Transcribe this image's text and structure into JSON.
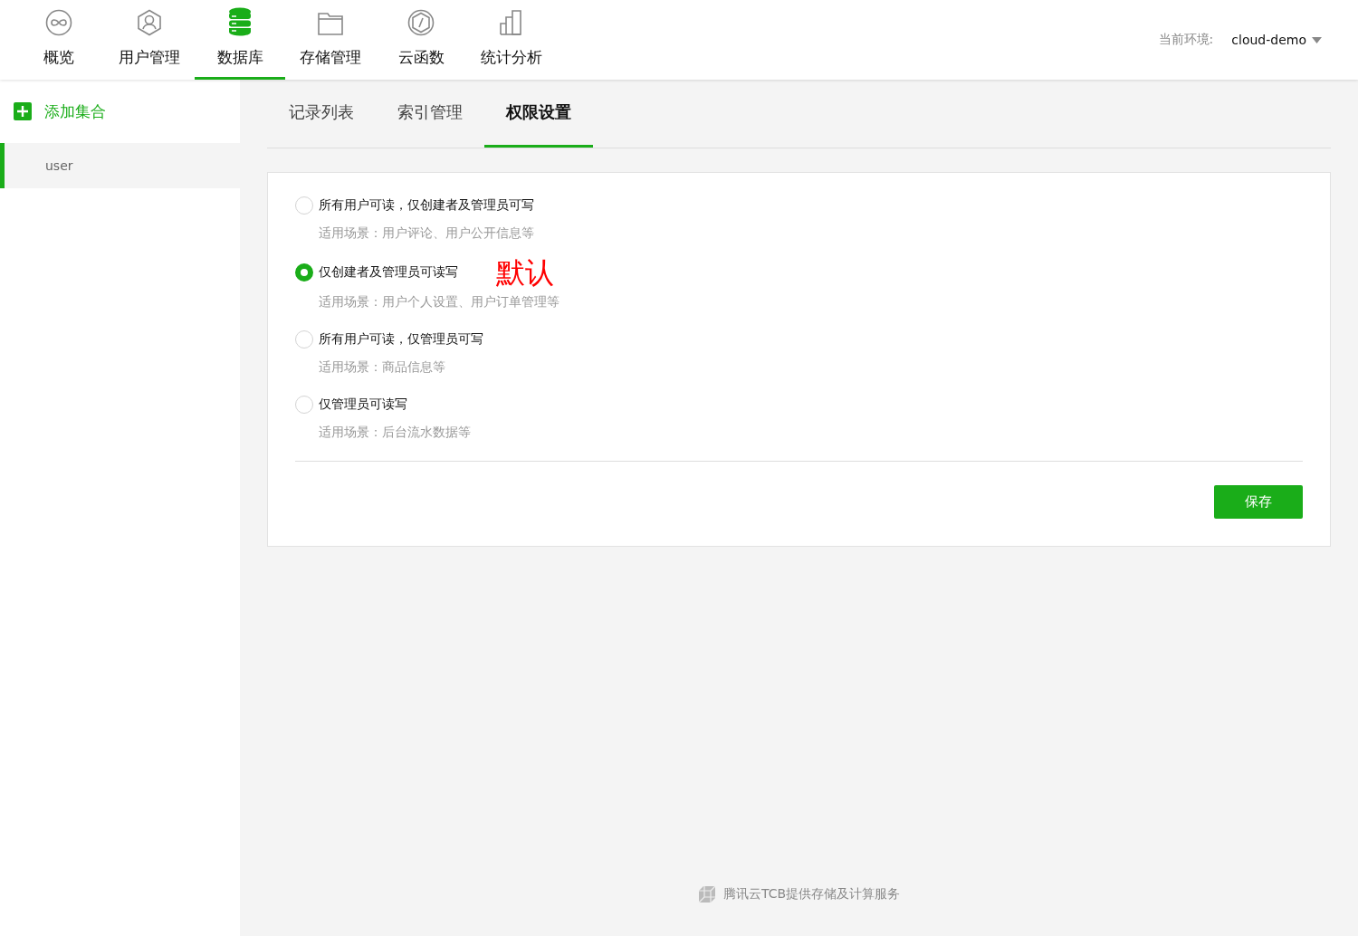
{
  "nav": [
    {
      "label": "概览",
      "selected": false
    },
    {
      "label": "用户管理",
      "selected": false
    },
    {
      "label": "数据库",
      "selected": true
    },
    {
      "label": "存储管理",
      "selected": false
    },
    {
      "label": "云函数",
      "selected": false
    },
    {
      "label": "统计分析",
      "selected": false
    }
  ],
  "environment": {
    "label": "当前环境:",
    "value": "cloud-demo"
  },
  "sidebar": {
    "add_button": "添加集合",
    "items": [
      {
        "label": "user",
        "selected": true
      }
    ]
  },
  "tabs": [
    {
      "label": "记录列表",
      "selected": false
    },
    {
      "label": "索引管理",
      "selected": false
    },
    {
      "label": "权限设置",
      "selected": true
    }
  ],
  "permissions": [
    {
      "label": "所有用户可读，仅创建者及管理员可写",
      "hint": "适用场景：用户评论、用户公开信息等",
      "selected": false
    },
    {
      "label": "仅创建者及管理员可读写",
      "hint": "适用场景：用户个人设置、用户订单管理等",
      "selected": true,
      "annotation": "默认"
    },
    {
      "label": "所有用户可读，仅管理员可写",
      "hint": "适用场景：商品信息等",
      "selected": false
    },
    {
      "label": "仅管理员可读写",
      "hint": "适用场景：后台流水数据等",
      "selected": false
    }
  ],
  "save_button": "保存",
  "footer": "腾讯云TCB提供存储及计算服务"
}
